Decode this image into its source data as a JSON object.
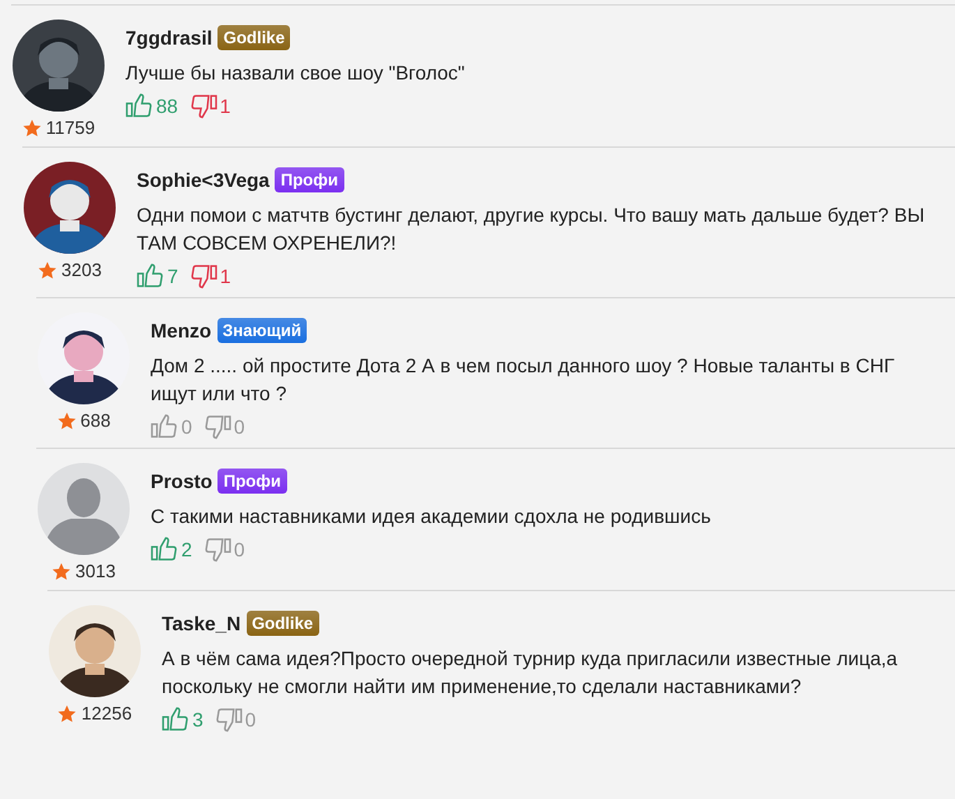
{
  "comments": [
    {
      "author": "7ggdrasil",
      "badge": {
        "label": "Godlike",
        "color": "#8a6414"
      },
      "avatar": {
        "kind": "picture"
      },
      "rating": "11759",
      "text": "Лучше бы назвали свое шоу \"Вголос\"",
      "likes": {
        "count": "88",
        "highlighted": true
      },
      "dislikes": {
        "count": "1",
        "highlighted": true
      },
      "children": [
        {
          "author": "Sophie<3Vega",
          "badge": {
            "label": "Профи",
            "color": "#7b2ff0"
          },
          "avatar": {
            "kind": "picture"
          },
          "rating": "3203",
          "text": "Одни помои с матчтв бустинг делают, другие курсы. Что вашу мать дальше будет? ВЫ ТАМ СОВСЕМ ОХРЕНЕЛИ?!",
          "likes": {
            "count": "7",
            "highlighted": true
          },
          "dislikes": {
            "count": "1",
            "highlighted": true
          },
          "children": [
            {
              "author": "Menzo",
              "badge": {
                "label": "Знающий",
                "color": "#1a6fe0"
              },
              "avatar": {
                "kind": "picture"
              },
              "rating": "688",
              "text": "Дом 2 ..... ой простите Дота 2 А в чем посыл данного шоу ? Новые таланты в СНГ ищут или что ?",
              "likes": {
                "count": "0",
                "highlighted": false
              },
              "dislikes": {
                "count": "0",
                "highlighted": false
              }
            },
            {
              "author": "Prosto",
              "badge": {
                "label": "Профи",
                "color": "#7b2ff0"
              },
              "avatar": {
                "kind": "silhouette"
              },
              "rating": "3013",
              "text": "С такими наставниками идея академии сдохла не родившись",
              "likes": {
                "count": "2",
                "highlighted": true
              },
              "dislikes": {
                "count": "0",
                "highlighted": false
              },
              "children": [
                {
                  "author": "Taske_N",
                  "badge": {
                    "label": "Godlike",
                    "color": "#8a6414"
                  },
                  "avatar": {
                    "kind": "picture"
                  },
                  "rating": "12256",
                  "text": "А в чём сама идея?Просто очередной турнир куда пригласили известные лица,а поскольку не смогли найти им применение,то сделали наставниками?",
                  "likes": {
                    "count": "3",
                    "highlighted": true
                  },
                  "dislikes": {
                    "count": "0",
                    "highlighted": false
                  }
                }
              ]
            }
          ]
        }
      ]
    }
  ]
}
